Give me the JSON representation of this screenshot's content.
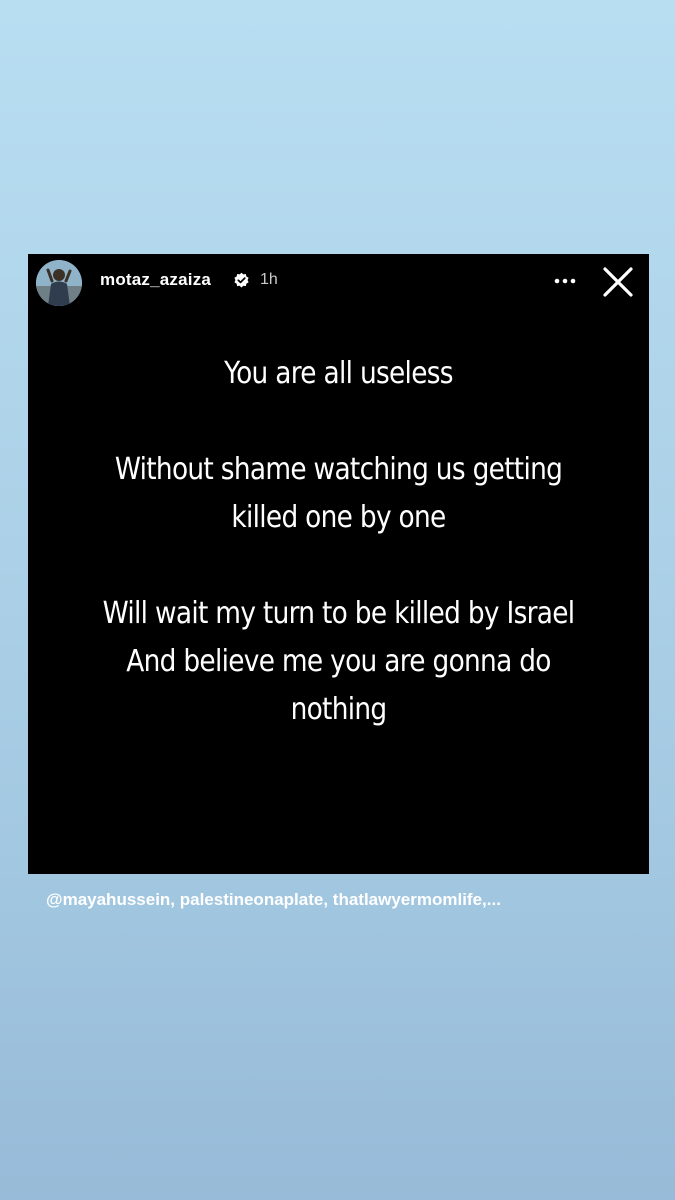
{
  "story": {
    "username": "motaz_azaiza",
    "timestamp": "1h",
    "verified": true,
    "avatar_icon": "profile-photo",
    "more_icon": "more-horizontal-icon",
    "close_icon": "close-icon",
    "message_paragraphs": [
      "You are all useless",
      "Without shame watching us getting\nkilled one by one",
      "Will wait my turn to be killed by Israel\nAnd believe me you are gonna do\nnothing"
    ]
  },
  "mentions": "@mayahussein, palestineonaplate, thatlawyermomlife,...",
  "colors": {
    "card_background": "#000000",
    "text": "#ffffff",
    "verified_badge": "#ffffff",
    "background_top": "#b8def2",
    "background_bottom": "#97bbd8"
  }
}
